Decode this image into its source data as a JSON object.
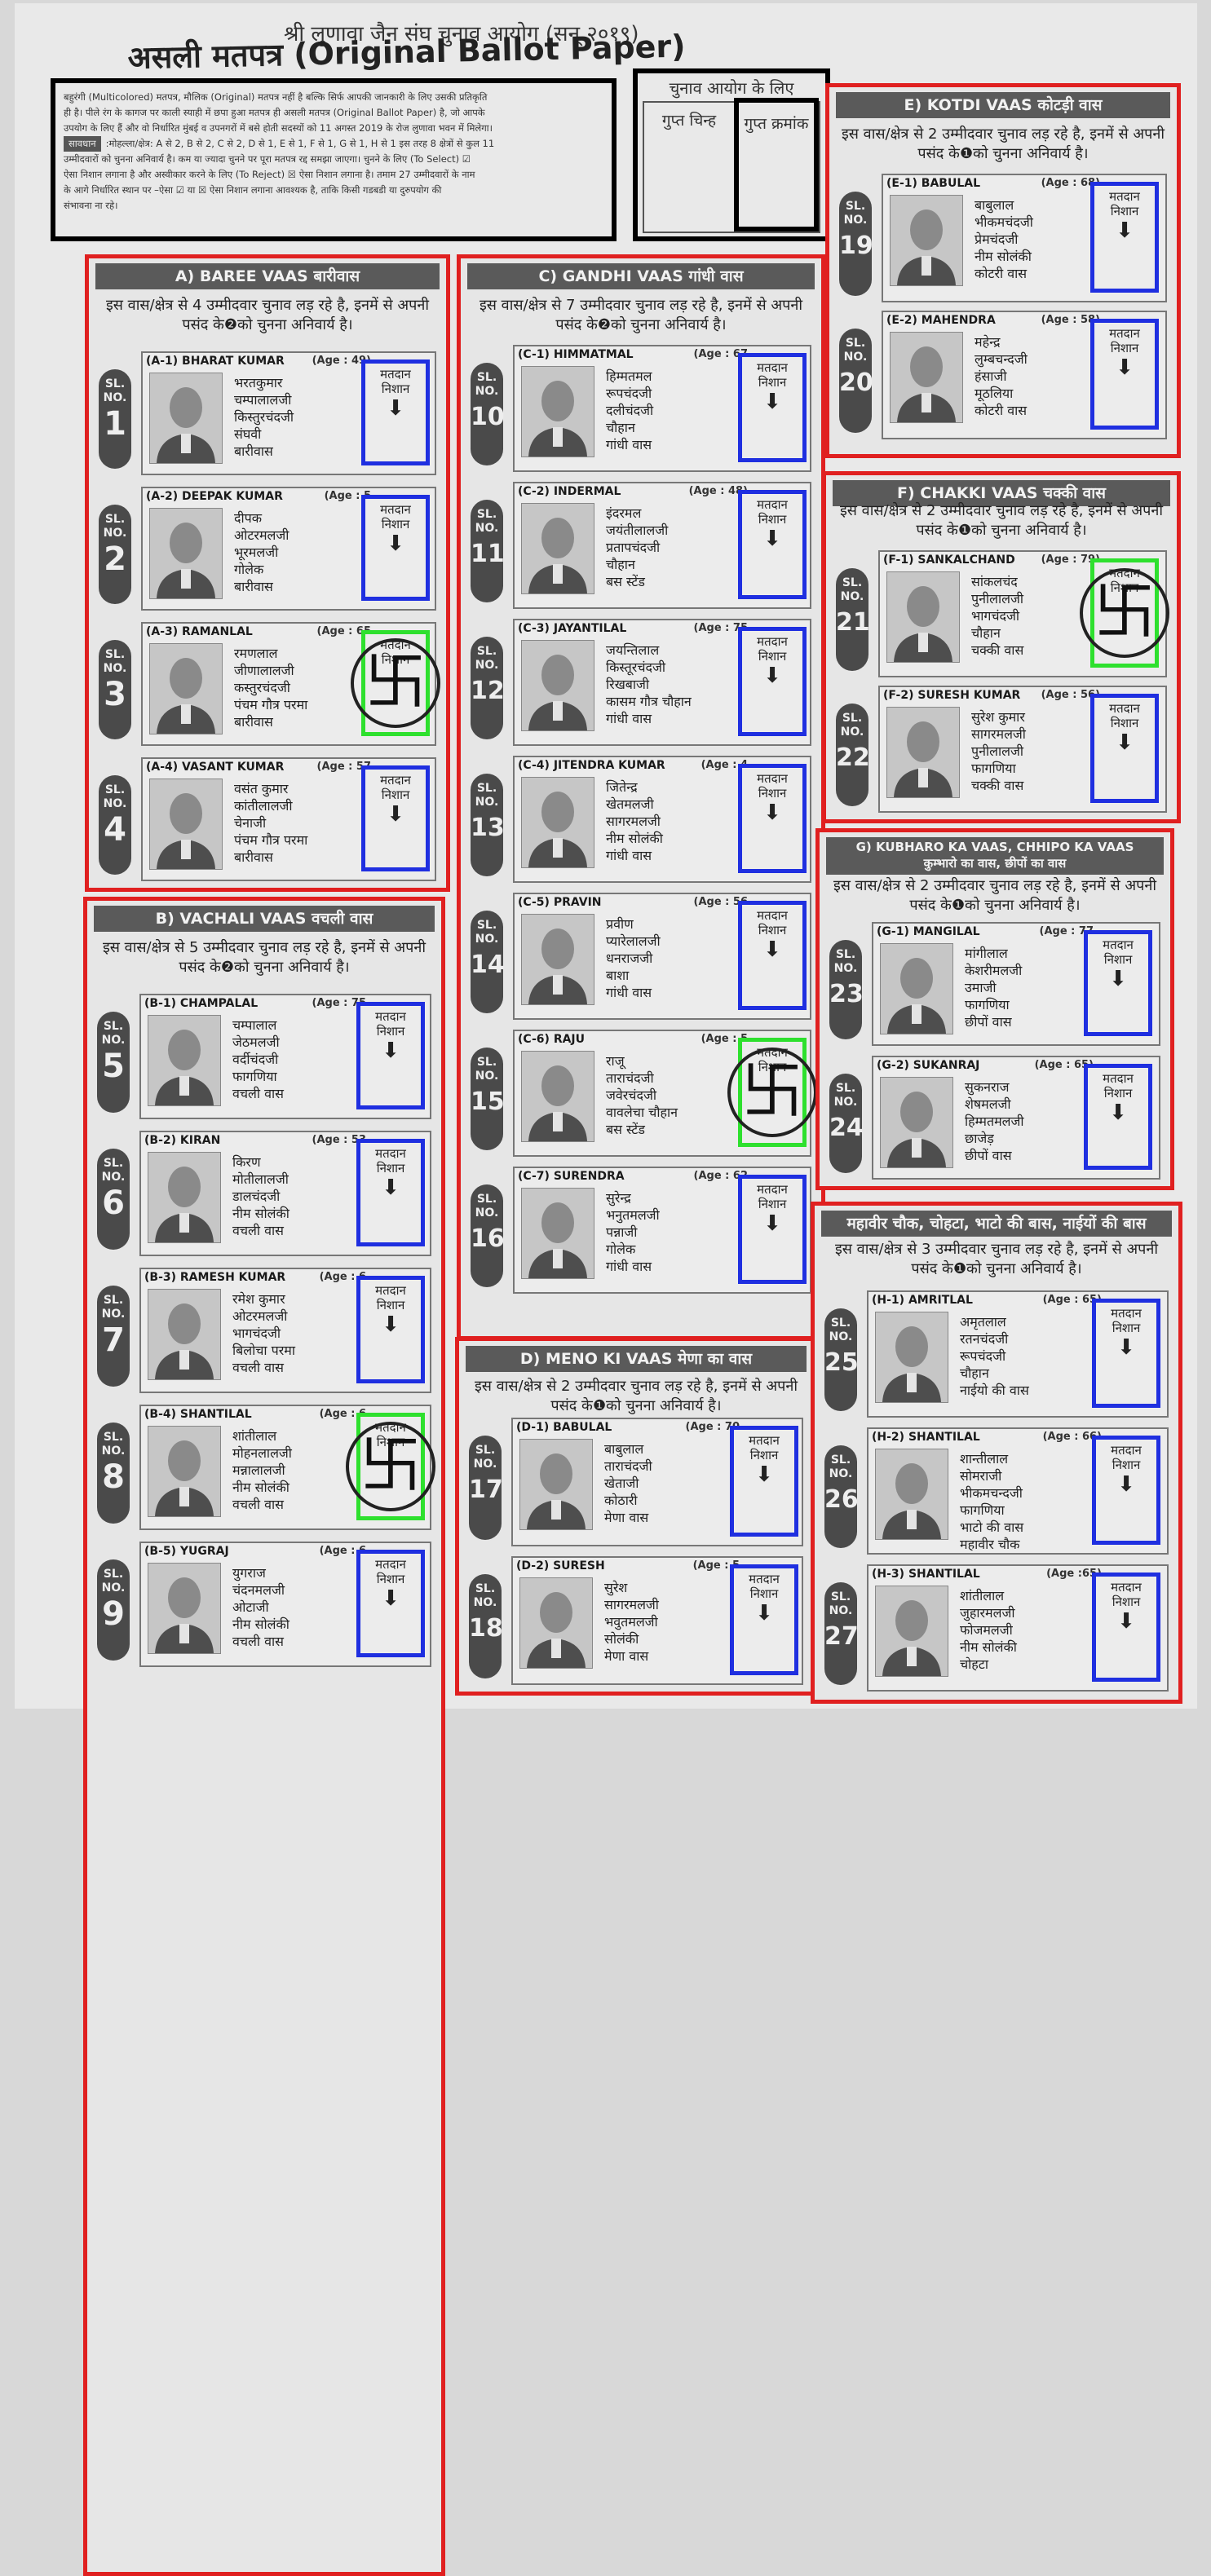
{
  "header": {
    "organization": "श्री लुणावा जैन संघ चुनाव आयोग (सन् २०१९)",
    "title": "असली मतपत्र (Original Ballot Paper)"
  },
  "instructions": {
    "lines": [
      "बहुरंगी (Multicolored) मतपत्र, मौलिक (Original) मतपत्र नहीं है बल्कि सिर्फ आपकी जानकारी के लिए उसकी प्रतिकृति",
      "ही है। पीले रंग के कागज पर काली स्याही में छपा हुआ मतपत्र ही असली मतपत्र (Original Ballot Paper) है, जो आपके",
      "उपयोग के लिए हैं और वो निर्धारित मुंबई व उपनगरों में बसे होती सदस्यों को 11 अगस्त 2019 के रोज लुणावा भवन में मिलेगा।"
    ],
    "caution_label": "सावधान",
    "caution_lines": [
      ":मोहल्ला/क्षेत्र: A से 2, B से 2, C से 2, D से 1, E से 1, F से 1, G से 1, H से 1 इस तरह 8 क्षेत्रों से कुल 11",
      "उम्मीदवारों को चुनना अनिवार्य है। कम या ज्यादा चुनने पर पूरा मतपत्र रद्द समझा जाएगा। चुनने के लिए (To Select) ☑",
      "ऐसा निशान लगाना है और अस्वीकार करने के लिए (To Reject) ☒ ऐसा निशान लगाना है। तमाम 27 उम्मीदवारों के नाम",
      "के आगे निर्धारित स्थान पर –ऐसा ☑ या ☒ ऐसा निशान लगाना आवश्यक है, ताकि किसी गडबडी या दुरुपयोग की",
      "संभावना ना रहे।"
    ]
  },
  "election_commission": {
    "title": "चुनाव आयोग के लिए",
    "secret_mark": "गुप्त चिन्ह",
    "secret_number": "गुप्त क्रमांक"
  },
  "labels": {
    "sl": "SL.",
    "no": "NO.",
    "vote_box": "मतदान निशान",
    "arrow": "⬇",
    "stamp": "卐"
  },
  "sections": [
    {
      "title": "A) BAREE VAAS बारीवास",
      "note": "इस वास/क्षेत्र से 4 उम्मीदवार चुनाव लड़ रहे है, इनमें से अपनी पसंद के❷को चुनना अनिवार्य है।",
      "candidates": [
        {
          "sl": "1",
          "code_name": "(A-1) BHARAT KUMAR",
          "age": "(Age : 49)",
          "details": [
            "भरतकुमार",
            "चम्पालालजी",
            "किस्तुरचंदजी",
            "संघवी",
            "बारीवास"
          ],
          "marked": false
        },
        {
          "sl": "2",
          "code_name": "(A-2) DEEPAK KUMAR",
          "age": "(Age : 5",
          "details": [
            "दीपक",
            "ओटरमलजी",
            "भूरमलजी",
            "गोलेक",
            "बारीवास"
          ],
          "marked": false
        },
        {
          "sl": "3",
          "code_name": "(A-3) RAMANLAL",
          "age": "(Age : 65",
          "details": [
            "रमणलाल",
            "जीणालालजी",
            "कस्तुरचंदजी",
            "पंचम गौत्र परमा",
            "बारीवास"
          ],
          "marked": true
        },
        {
          "sl": "4",
          "code_name": "(A-4) VASANT KUMAR",
          "age": "(Age : 57",
          "details": [
            "वसंत कुमार",
            "कांतीलालजी",
            "चेनाजी",
            "पंचम गौत्र परमा",
            "बारीवास"
          ],
          "marked": false
        }
      ]
    },
    {
      "title": "B) VACHALI VAAS वचली वास",
      "note": "इस वास/क्षेत्र से 5 उम्मीदवार चुनाव लड़ रहे है, इनमें से अपनी पसंद के❷को चुनना अनिवार्य है।",
      "candidates": [
        {
          "sl": "5",
          "code_name": "(B-1) CHAMPALAL",
          "age": "(Age : 75",
          "details": [
            "चम्पालाल",
            "जेठमलजी",
            "वर्दीचंदजी",
            "फागणिया",
            "वचली वास"
          ],
          "marked": false
        },
        {
          "sl": "6",
          "code_name": "(B-2) KIRAN",
          "age": "(Age : 53",
          "details": [
            "किरण",
            "मोतीलालजी",
            "डालचंदजी",
            "नीम सोलंकी",
            "वचली वास"
          ],
          "marked": false
        },
        {
          "sl": "7",
          "code_name": "(B-3) RAMESH KUMAR",
          "age": "(Age : 6",
          "details": [
            "रमेश कुमार",
            "ओटरमलजी",
            "भागचंदजी",
            "बिलोचा परमा",
            "वचली वास"
          ],
          "marked": false
        },
        {
          "sl": "8",
          "code_name": "(B-4) SHANTILAL",
          "age": "(Age : 6",
          "details": [
            "शांतीलाल",
            "मोहनलालजी",
            "मन्नालालजी",
            "नीम सोलंकी",
            "वचली वास"
          ],
          "marked": true
        },
        {
          "sl": "9",
          "code_name": "(B-5) YUGRAJ",
          "age": "(Age : 6",
          "details": [
            "युगराज",
            "चंदनमलजी",
            "ओटाजी",
            "नीम सोलंकी",
            "वचली वास"
          ],
          "marked": false
        }
      ]
    },
    {
      "title": "C) GANDHI VAAS गांधी वास",
      "note": "इस वास/क्षेत्र से 7 उम्मीदवार चुनाव लड़ रहे है, इनमें से अपनी पसंद के❷को चुनना अनिवार्य है।",
      "candidates": [
        {
          "sl": "10",
          "code_name": "(C-1) HIMMATMAL",
          "age": "(Age : 67",
          "details": [
            "हिम्मतमल",
            "रूपचंदजी",
            "दलीचंदजी",
            "चौहान",
            "गांधी वास"
          ],
          "marked": false
        },
        {
          "sl": "11",
          "code_name": "(C-2) INDERMAL",
          "age": "(Age : 48)",
          "details": [
            "इंदरमल",
            "जयंतीलालजी",
            "प्रतापचंदजी",
            "चौहान",
            "बस स्टेंड"
          ],
          "marked": false
        },
        {
          "sl": "12",
          "code_name": "(C-3) JAYANTILAL",
          "age": "(Age : 75",
          "details": [
            "जयन्तिलाल",
            "किस्तूरचंदजी",
            "रिखबाजी",
            "कासम गौत्र चौहान",
            "गांधी वास"
          ],
          "marked": false
        },
        {
          "sl": "13",
          "code_name": "(C-4) JITENDRA KUMAR",
          "age": "(Age : 4",
          "details": [
            "जितेन्द्र",
            "खेतमलजी",
            "सागरमलजी",
            "नीम सोलंकी",
            "गांधी वास"
          ],
          "marked": false
        },
        {
          "sl": "14",
          "code_name": "(C-5) PRAVIN",
          "age": "(Age : 56",
          "details": [
            "प्रवीण",
            "प्यारेलालजी",
            "धनराजजी",
            "बाशा",
            "गांधी वास"
          ],
          "marked": false
        },
        {
          "sl": "15",
          "code_name": "(C-6) RAJU",
          "age": "(Age : 5",
          "details": [
            "राजू",
            "ताराचंदजी",
            "जवेरचंदजी",
            "वावलेचा चौहान",
            "बस स्टेंड"
          ],
          "marked": true
        },
        {
          "sl": "16",
          "code_name": "(C-7) SURENDRA",
          "age": "(Age : 62",
          "details": [
            "सुरेन्द्र",
            "भनुतमलजी",
            "पन्नाजी",
            "गोलेक",
            "गांधी वास"
          ],
          "marked": false
        }
      ]
    },
    {
      "title": "D) MENO KI VAAS मेणा का वास",
      "note": "इस वास/क्षेत्र से 2 उम्मीदवार चुनाव लड़ रहे है, इनमें से अपनी पसंद के❶को चुनना अनिवार्य है।",
      "candidates": [
        {
          "sl": "17",
          "code_name": "(D-1) BABULAL",
          "age": "(Age : 70",
          "details": [
            "बाबुलाल",
            "ताराचंदजी",
            "खेताजी",
            "कोठारी",
            "मेणा वास"
          ],
          "marked": false
        },
        {
          "sl": "18",
          "code_name": "(D-2) SURESH",
          "age": "(Age : 5",
          "details": [
            "सुरेश",
            "सागरमलजी",
            "भवुतमलजी",
            "सोलंकी",
            "मेणा वास"
          ],
          "marked": false
        }
      ]
    },
    {
      "title": "E) KOTDI VAAS कोटड़ी वास",
      "note": "इस वास/क्षेत्र से 2 उम्मीदवार चुनाव लड़ रहे है, इनमें से अपनी पसंद के❶को चुनना अनिवार्य है।",
      "candidates": [
        {
          "sl": "19",
          "code_name": "(E-1) BABULAL",
          "age": "(Age : 68)",
          "details": [
            "बाबुलाल",
            "भीकमचंदजी",
            "प्रेमचंदजी",
            "नीम सोलंकी",
            "कोटरी वास"
          ],
          "marked": false
        },
        {
          "sl": "20",
          "code_name": "(E-2) MAHENDRA",
          "age": "(Age : 58)",
          "details": [
            "महेन्द्र",
            "लुम्बचन्दजी",
            "हंसाजी",
            "मूठलिया",
            "कोटरी वास"
          ],
          "marked": false
        }
      ]
    },
    {
      "title": "F) CHAKKI VAAS चक्की वास",
      "note": "इस वास/क्षेत्र से 2 उम्मीदवार चुनाव लड़ रहे है, इनमें से अपनी पसंद के❶को चुनना अनिवार्य है।",
      "candidates": [
        {
          "sl": "21",
          "code_name": "(F-1) SANKALCHAND",
          "age": "(Age : 79)",
          "details": [
            "सांकलचंद",
            "पुनीलालजी",
            "भागचंदजी",
            "चौहान",
            "चक्की वास"
          ],
          "marked": true
        },
        {
          "sl": "22",
          "code_name": "(F-2) SURESH KUMAR",
          "age": "(Age : 56)",
          "details": [
            "सुरेश कुमार",
            "सागरमलजी",
            "पुनीलालजी",
            "फागणिया",
            "चक्की वास"
          ],
          "marked": false
        }
      ]
    },
    {
      "title": "G) KUBHARO KA VAAS, CHHIPO KA VAAS",
      "subtitle": "कुम्भारो का वास, छीपों का वास",
      "note": "इस वास/क्षेत्र से 2 उम्मीदवार चुनाव लड़ रहे है, इनमें से अपनी पसंद के❶को चुनना अनिवार्य है।",
      "candidates": [
        {
          "sl": "23",
          "code_name": "(G-1) MANGILAL",
          "age": "(Age : 77",
          "details": [
            "मांगीलाल",
            "केशरीमलजी",
            "उमाजी",
            "फागणिया",
            "छीपों वास"
          ],
          "marked": false
        },
        {
          "sl": "24",
          "code_name": "(G-2) SUKANRAJ",
          "age": "(Age : 65)",
          "details": [
            "सुकनराज",
            "शेषमलजी",
            "हिम्मतमलजी",
            "छाजेड़",
            "छीपों वास"
          ],
          "marked": false
        }
      ]
    },
    {
      "title": "महावीर चौक, चोहटा, भाटो की बास, नाईयों की बास",
      "note": "इस वास/क्षेत्र से 3 उम्मीदवार चुनाव लड़ रहे है, इनमें से अपनी पसंद के❶को चुनना अनिवार्य है।",
      "candidates": [
        {
          "sl": "25",
          "code_name": "(H-1) AMRITLAL",
          "age": "(Age : 65)",
          "details": [
            "अमृतलाल",
            "रतनचंदजी",
            "रूपचंदजी",
            "चौहान",
            "नाईयो की वास"
          ],
          "marked": false
        },
        {
          "sl": "26",
          "code_name": "(H-2) SHANTILAL",
          "age": "(Age : 66)",
          "details": [
            "शान्तीलाल",
            "सोमराजी",
            "भीकमचन्दजी",
            "फागणिया",
            "भाटो की वास",
            "महावीर चौक"
          ],
          "marked": false
        },
        {
          "sl": "27",
          "code_name": "(H-3) SHANTILAL",
          "age": "(Age :65)",
          "details": [
            "शांतीलाल",
            "जुहारमलजी",
            "फोजमलजी",
            "नीम सोलंकी",
            "चोहटा"
          ],
          "marked": false
        }
      ]
    }
  ]
}
